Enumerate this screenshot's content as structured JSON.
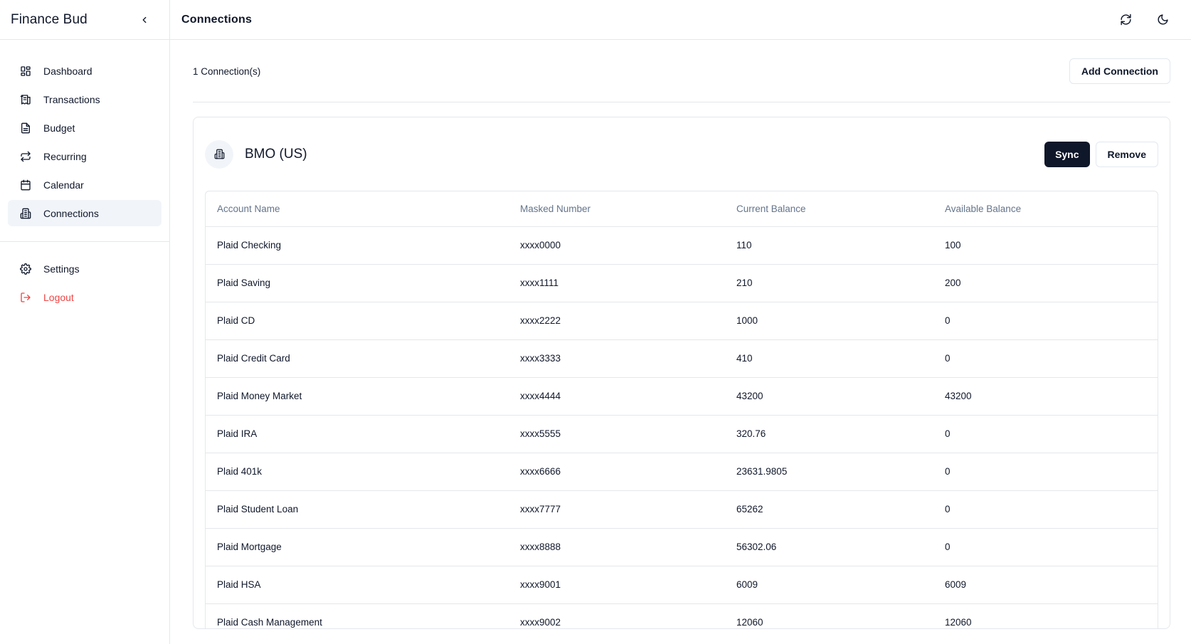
{
  "app": {
    "title": "Finance Bud"
  },
  "sidebar": {
    "items": [
      {
        "label": "Dashboard",
        "icon": "dashboard-icon"
      },
      {
        "label": "Transactions",
        "icon": "receipt-icon"
      },
      {
        "label": "Budget",
        "icon": "document-icon"
      },
      {
        "label": "Recurring",
        "icon": "repeat-icon"
      },
      {
        "label": "Calendar",
        "icon": "calendar-icon"
      },
      {
        "label": "Connections",
        "icon": "bank-icon",
        "active": true
      }
    ],
    "settings_label": "Settings",
    "logout_label": "Logout"
  },
  "header": {
    "title": "Connections"
  },
  "main": {
    "count_text": "1 Connection(s)",
    "add_button_label": "Add Connection",
    "connection": {
      "bank_name": "BMO (US)",
      "sync_label": "Sync",
      "remove_label": "Remove",
      "columns": [
        "Account Name",
        "Masked Number",
        "Current Balance",
        "Available Balance"
      ],
      "rows": [
        [
          "Plaid Checking",
          "xxxx0000",
          "110",
          "100"
        ],
        [
          "Plaid Saving",
          "xxxx1111",
          "210",
          "200"
        ],
        [
          "Plaid CD",
          "xxxx2222",
          "1000",
          "0"
        ],
        [
          "Plaid Credit Card",
          "xxxx3333",
          "410",
          "0"
        ],
        [
          "Plaid Money Market",
          "xxxx4444",
          "43200",
          "43200"
        ],
        [
          "Plaid IRA",
          "xxxx5555",
          "320.76",
          "0"
        ],
        [
          "Plaid 401k",
          "xxxx6666",
          "23631.9805",
          "0"
        ],
        [
          "Plaid Student Loan",
          "xxxx7777",
          "65262",
          "0"
        ],
        [
          "Plaid Mortgage",
          "xxxx8888",
          "56302.06",
          "0"
        ],
        [
          "Plaid HSA",
          "xxxx9001",
          "6009",
          "6009"
        ],
        [
          "Plaid Cash Management",
          "xxxx9002",
          "12060",
          "12060"
        ]
      ]
    }
  },
  "colors": {
    "accent_dark": "#0f172a",
    "logout_red": "#ef4444",
    "muted": "#64748b"
  }
}
